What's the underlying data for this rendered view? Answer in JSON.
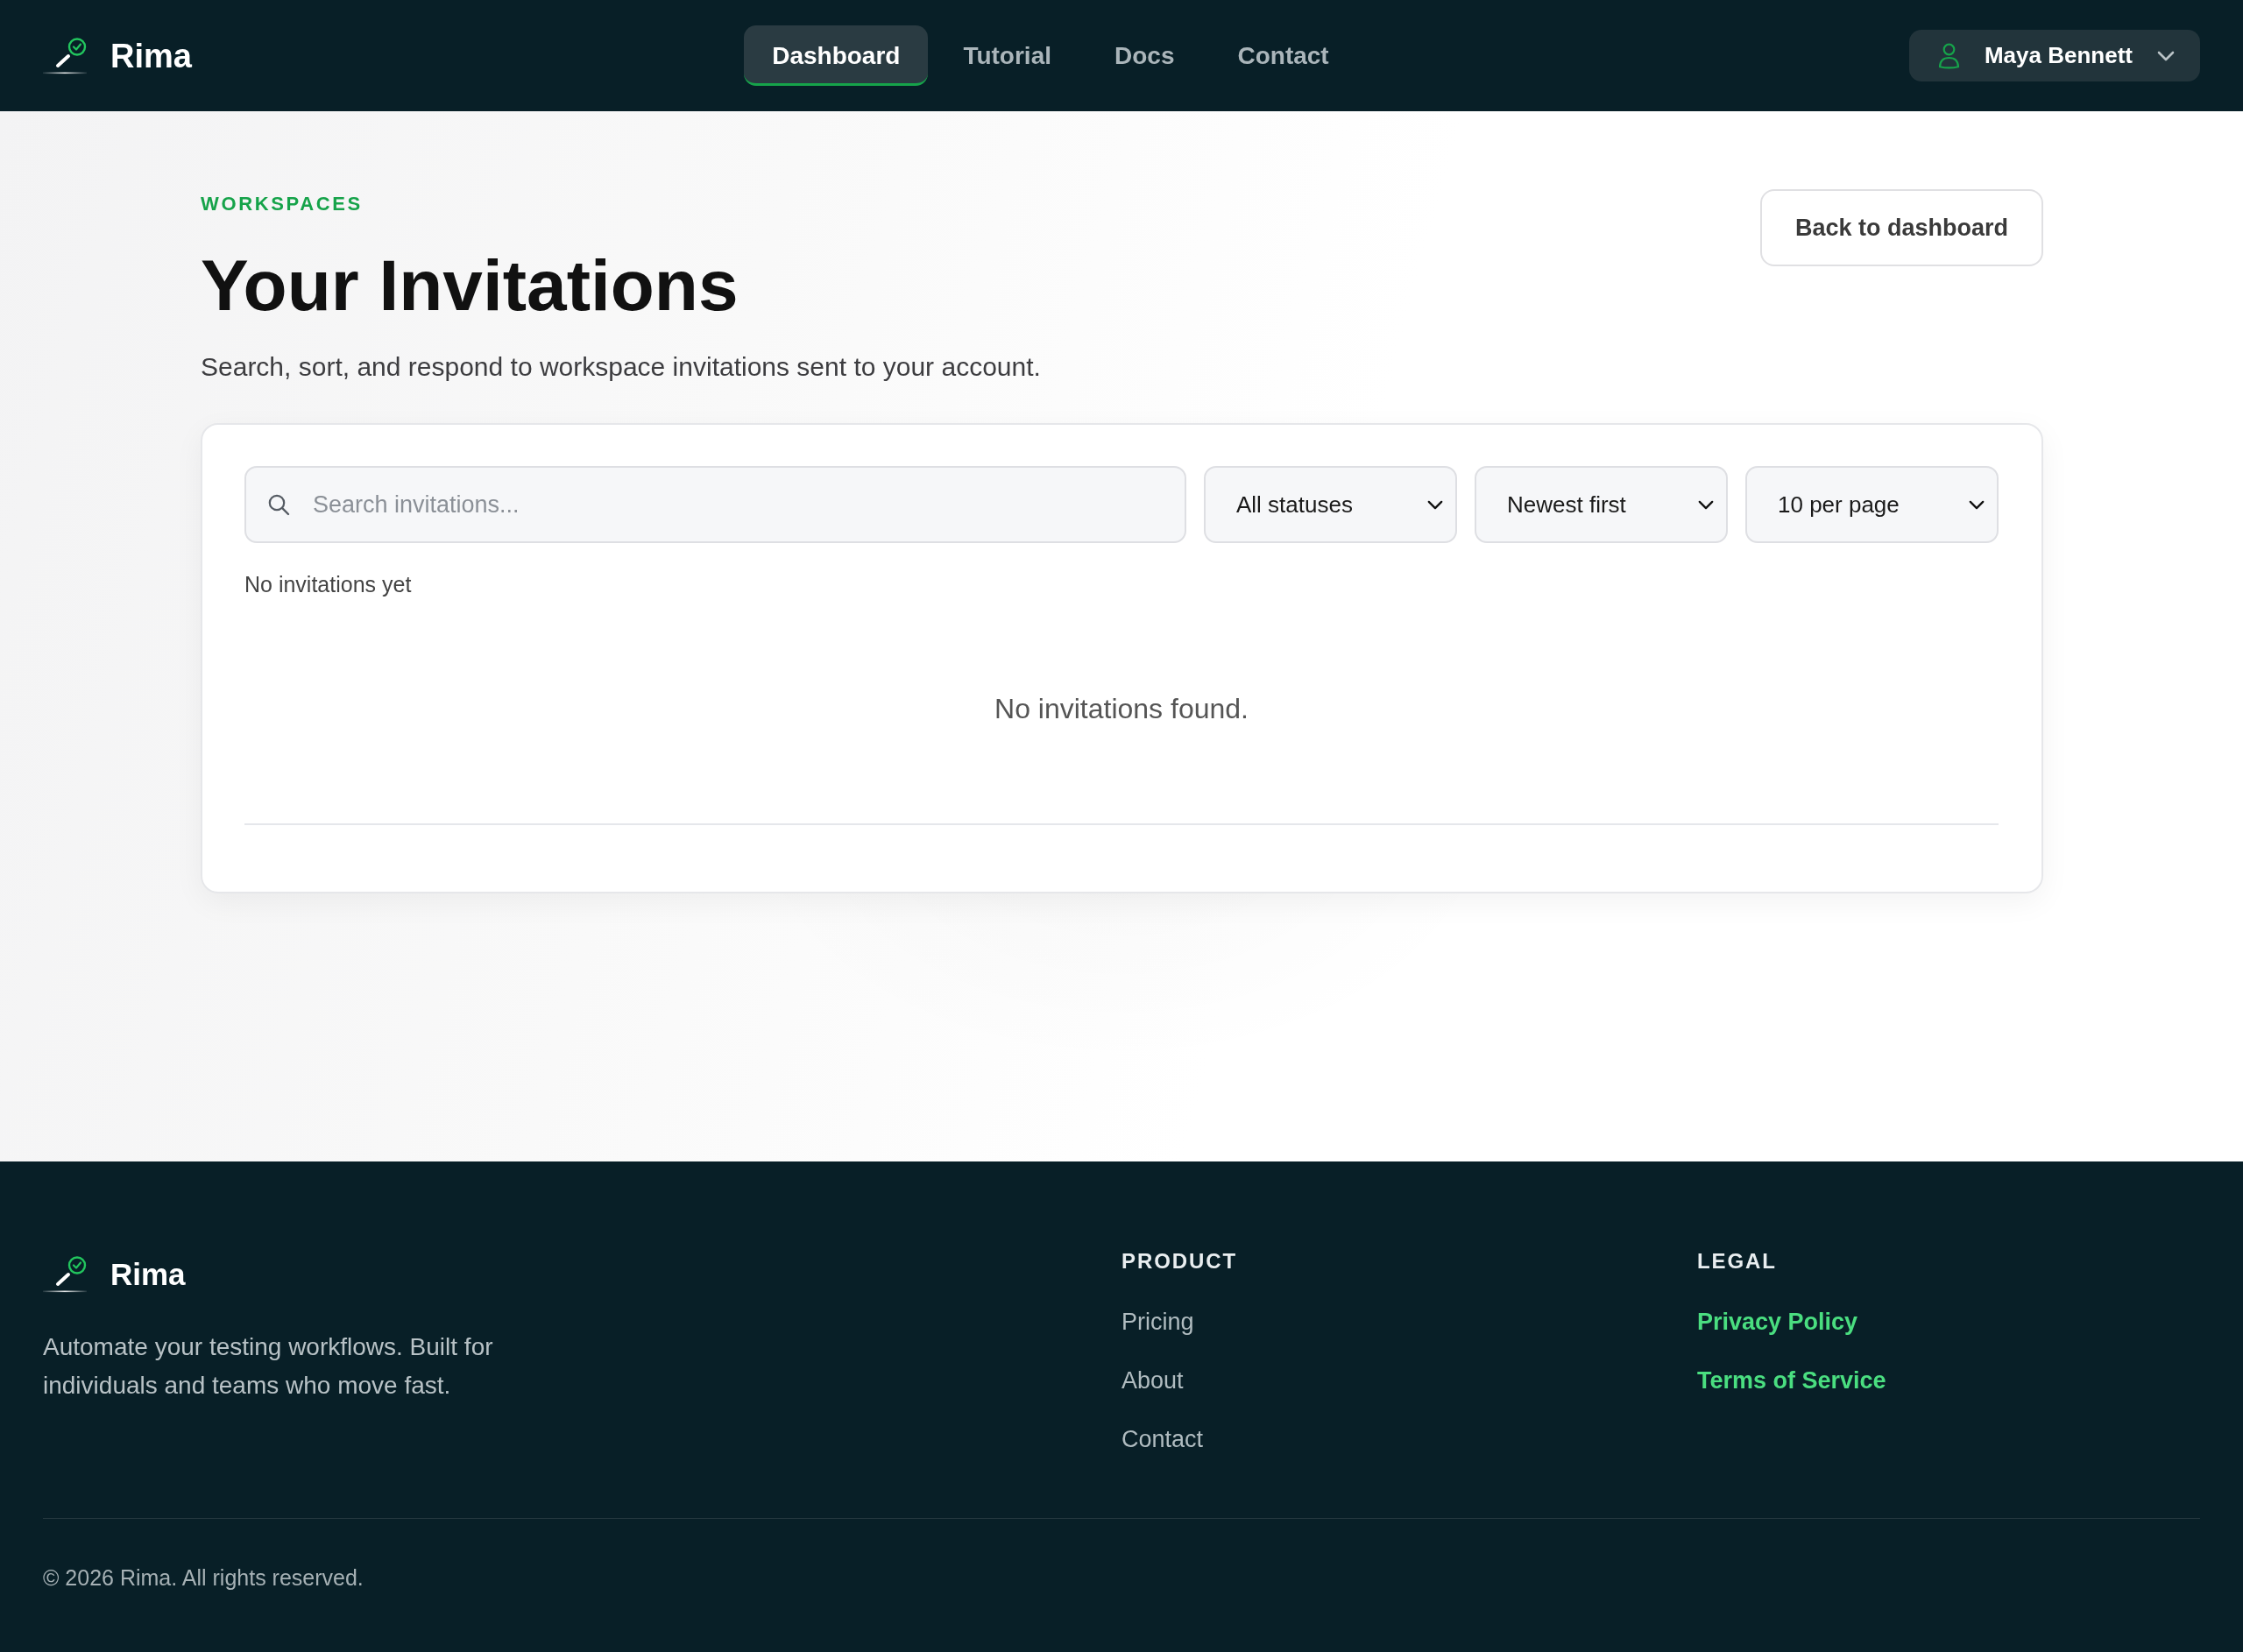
{
  "navbar": {
    "brand": "Rima",
    "links": [
      {
        "label": "Dashboard",
        "selected": true
      },
      {
        "label": "Tutorial",
        "selected": false
      },
      {
        "label": "Docs",
        "selected": false
      },
      {
        "label": "Contact",
        "selected": false
      }
    ],
    "user_menu": {
      "name": "Maya Bennett"
    }
  },
  "header": {
    "eyebrow": "WORKSPACES",
    "title": "Your Invitations",
    "subtitle": "Search, sort, and respond to workspace invitations sent to your account.",
    "back_button": "Back to dashboard"
  },
  "filters": {
    "search": {
      "placeholder": "Search invitations..."
    },
    "selects": [
      {
        "value": "All statuses"
      },
      {
        "value": "Newest first"
      },
      {
        "value": "10 per page"
      }
    ]
  },
  "summary": "No invitations yet",
  "empty_state": "No invitations found.",
  "footer": {
    "brand": "Rima",
    "tagline": "Automate your testing workflows. Built for individuals and teams who move fast.",
    "columns": [
      {
        "heading": "PRODUCT",
        "kind": "plain",
        "links": [
          "Pricing",
          "About",
          "Contact"
        ]
      },
      {
        "heading": "LEGAL",
        "kind": "accent",
        "links": [
          "Privacy Policy",
          "Terms of Service"
        ]
      }
    ],
    "copyright": "© 2026 Rima. All rights reserved."
  }
}
